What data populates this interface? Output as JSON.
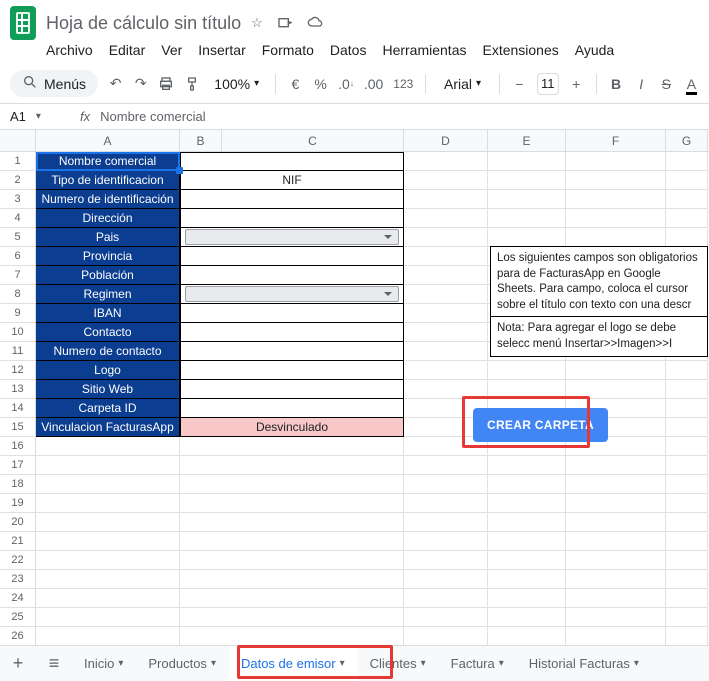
{
  "header": {
    "doc_title": "Hoja de cálculo sin título",
    "menus": [
      "Archivo",
      "Editar",
      "Ver",
      "Insertar",
      "Formato",
      "Datos",
      "Herramientas",
      "Extensiones",
      "Ayuda"
    ]
  },
  "toolbar": {
    "menus_label": "Menús",
    "zoom": "100%",
    "font": "Arial",
    "font_size": "11"
  },
  "namebox": {
    "ref": "A1",
    "formula_text": "Nombre comercial"
  },
  "columns": [
    "A",
    "B",
    "C",
    "D",
    "E",
    "F",
    "G"
  ],
  "labels": [
    "Nombre comercial",
    "Tipo de identificacion",
    "Numero de identificación",
    "Dirección",
    "Pais",
    "Provincia",
    "Población",
    "Regimen",
    "IBAN",
    "Contacto",
    "Numero de contacto",
    "Logo",
    "Sitio Web",
    "Carpeta ID",
    "Vinculacion FacturasApp"
  ],
  "row2_c": "NIF",
  "row15_c": "Desvinculado",
  "info1": "Los siguientes campos son obligatorios para de FacturasApp en Google Sheets. Para campo, coloca el cursor sobre el título con texto con una descr",
  "info2": "Nota: Para agregar el logo se debe selecc menú Insertar>>Imagen>>I",
  "button_label": "CREAR CARPETA",
  "tabs": [
    "Inicio",
    "Productos",
    "Datos de emisor",
    "Clientes",
    "Factura",
    "Historial Facturas"
  ],
  "active_tab_index": 2
}
